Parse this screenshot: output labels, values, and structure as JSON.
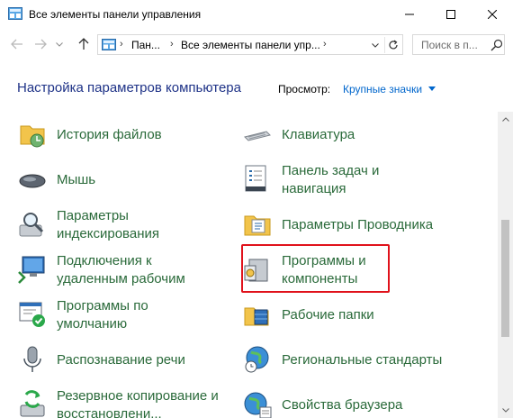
{
  "window": {
    "title": "Все элементы панели управления",
    "minimize_icon": "minimize-icon",
    "maximize_icon": "maximize-icon",
    "close_icon": "close-icon"
  },
  "navigation": {
    "breadcrumb": [
      "Пан...",
      "Все элементы панели упр..."
    ],
    "search_placeholder": "Поиск в п...",
    "back_icon": "arrow-left-icon",
    "forward_icon": "arrow-right-icon",
    "up_icon": "arrow-up-icon",
    "refresh_icon": "refresh-icon"
  },
  "header": {
    "title": "Настройка параметров компьютера",
    "view_label": "Просмотр:",
    "view_value": "Крупные значки"
  },
  "items": [
    {
      "label": "История файлов",
      "icon": "file-history-icon"
    },
    {
      "label": "Клавиатура",
      "icon": "keyboard-icon"
    },
    {
      "label": "Мышь",
      "icon": "mouse-icon"
    },
    {
      "label": "Панель задач и навигация",
      "icon": "taskbar-icon"
    },
    {
      "label": "Параметры индексирования",
      "icon": "indexing-icon"
    },
    {
      "label": "Параметры Проводника",
      "icon": "folder-options-icon"
    },
    {
      "label": "Подключения к удаленным рабочим",
      "icon": "remote-desktop-icon"
    },
    {
      "label": "Программы и компоненты",
      "icon": "programs-features-icon"
    },
    {
      "label": "Программы по умолчанию",
      "icon": "default-programs-icon"
    },
    {
      "label": "Рабочие папки",
      "icon": "work-folders-icon"
    },
    {
      "label": "Распознавание речи",
      "icon": "microphone-icon"
    },
    {
      "label": "Региональные стандарты",
      "icon": "globe-clock-icon"
    },
    {
      "label": "Резервное копирование и восстановлени...",
      "icon": "backup-icon"
    },
    {
      "label": "Свойства браузера",
      "icon": "globe-icon"
    }
  ],
  "highlighted_item": "Программы и компоненты",
  "colors": {
    "link_green": "#2a6a3a",
    "title_blue": "#1e3287",
    "accent_blue": "#0066cc",
    "highlight_red": "#e0121b"
  }
}
